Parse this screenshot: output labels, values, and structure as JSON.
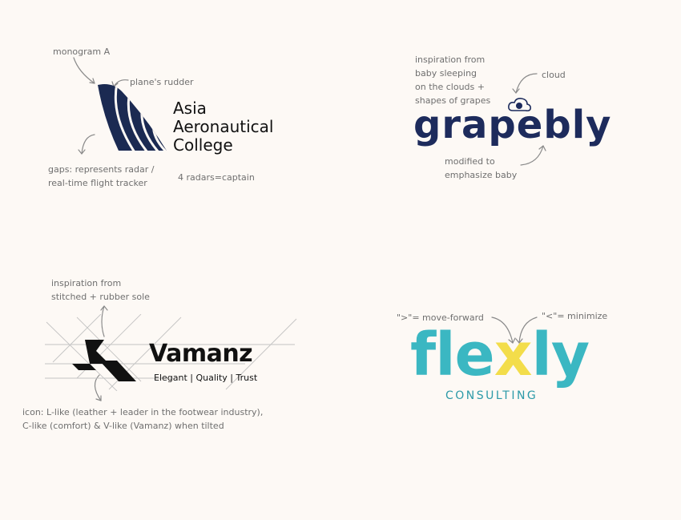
{
  "colors": {
    "background": "#fdf9f5",
    "annotation_text": "#6f6f6f",
    "asia_navy": "#1b2a52",
    "grapebly_navy": "#1d2b5c",
    "flexly_teal": "#3bb7c2",
    "flexly_yellow": "#f3dd4a"
  },
  "asia": {
    "name_lines": [
      "Asia",
      "Aeronautical",
      "College"
    ],
    "notes": {
      "monogram": "monogram A",
      "rudder": "plane's rudder",
      "gaps_1": "gaps: represents radar /",
      "gaps_2": "real-time flight tracker",
      "radars": "4 radars=captain"
    },
    "icon": "sail-monogram-icon"
  },
  "grapebly": {
    "wordmark": "grapebly",
    "notes": {
      "inspiration_1": "inspiration from",
      "inspiration_2": "baby sleeping",
      "inspiration_3": "on the clouds +",
      "inspiration_4": "shapes of grapes",
      "cloud": "cloud",
      "modified_1": "modified to",
      "modified_2": "emphasize baby"
    },
    "icon": "cloud-icon"
  },
  "vamanz": {
    "wordmark": "Vamanz",
    "tagline": "Elegant | Quality | Trust",
    "notes": {
      "inspiration_1": "inspiration from",
      "inspiration_2": "stitched + rubber sole",
      "icon_1": "icon: L-like (leather + leader in the footwear industry),",
      "icon_2": "C-like (comfort) & V-like (Vamanz) when tilted"
    },
    "icon": "lcv-mark-icon"
  },
  "flexly": {
    "wordmark_pre": "fle",
    "wordmark_x": "x",
    "wordmark_post": "ly",
    "subline": "CONSULTING",
    "notes": {
      "forward": "\">\"= move-forward",
      "minimize": "\"<\"= minimize"
    },
    "icon": "chevron-x-icon"
  }
}
